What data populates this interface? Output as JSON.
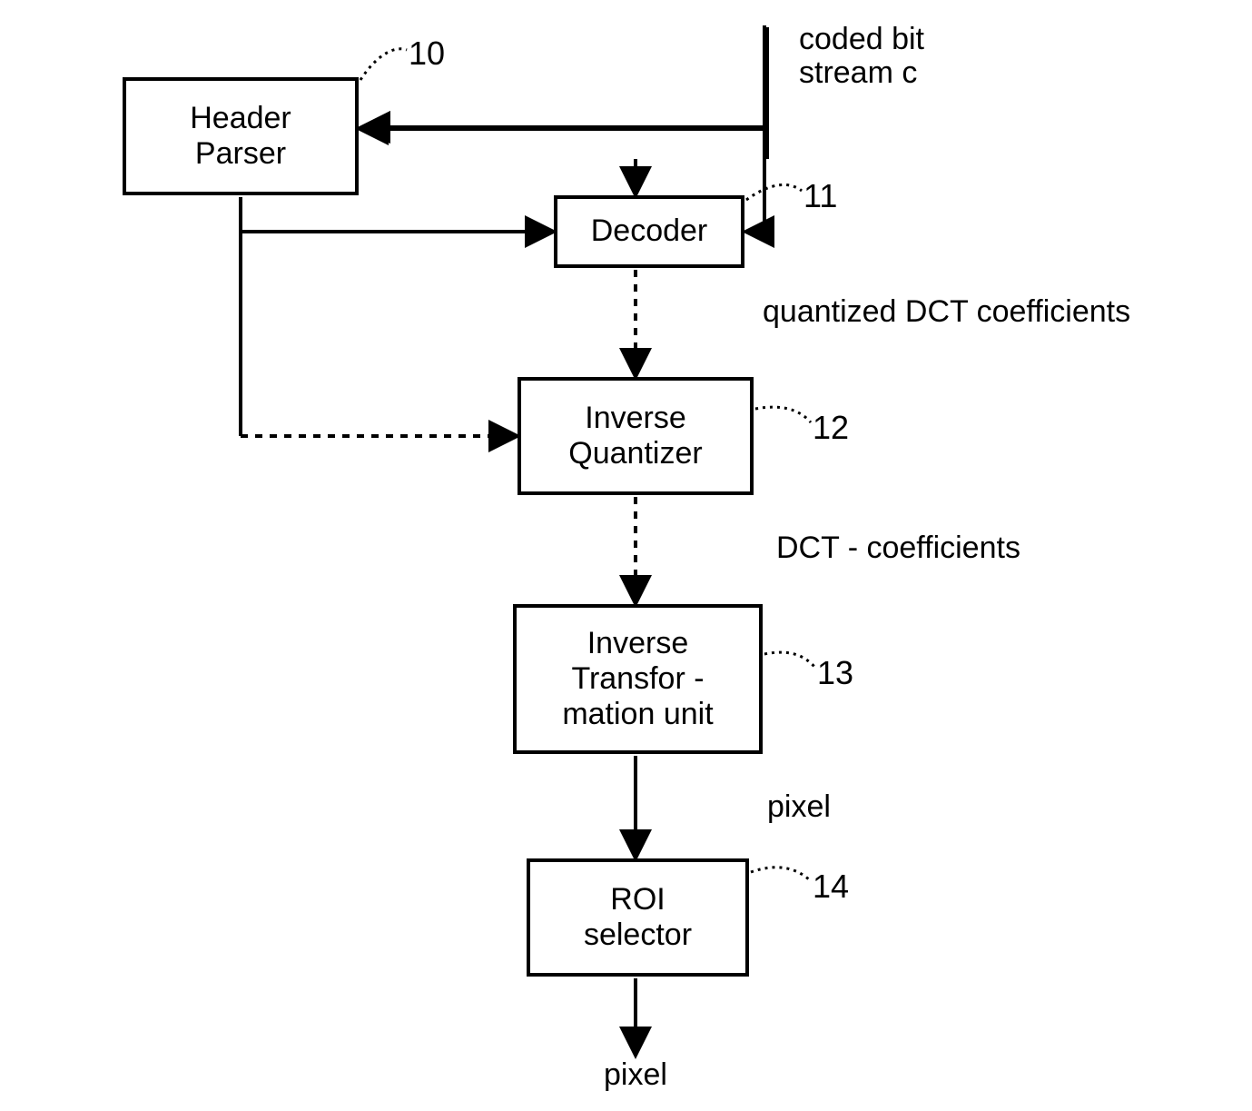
{
  "input_label": "coded bit\nstream c",
  "blocks": {
    "header_parser": {
      "text": "Header\nParser",
      "ref": "10"
    },
    "decoder": {
      "text": "Decoder",
      "ref": "11"
    },
    "inv_quant": {
      "text": "Inverse\nQuantizer",
      "ref": "12"
    },
    "inv_trans": {
      "text": "Inverse\nTransfor -\nmation unit",
      "ref": "13"
    },
    "roi_sel": {
      "text": "ROI\nselector",
      "ref": "14"
    }
  },
  "edge_labels": {
    "qdct": "quantized DCT coefficients",
    "dct": "DCT - coefficients",
    "pixel1": "pixel",
    "pixel2": "pixel"
  }
}
